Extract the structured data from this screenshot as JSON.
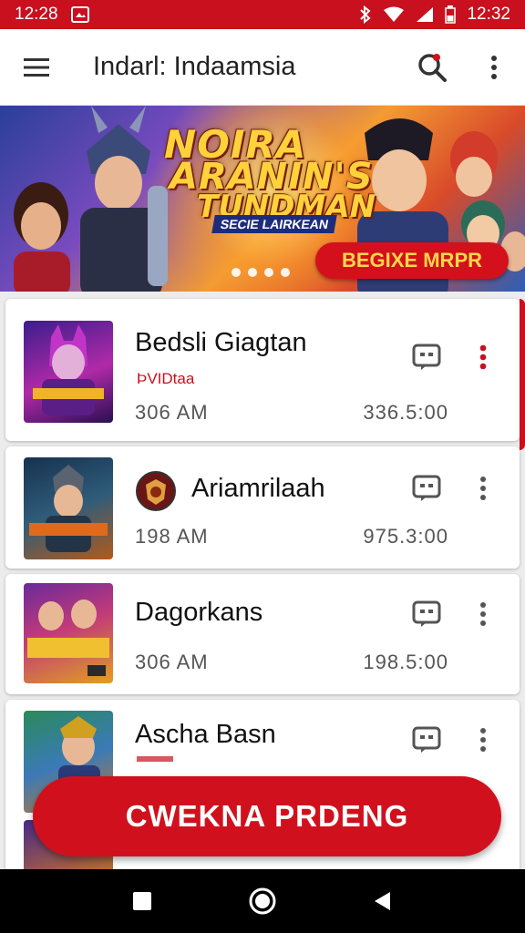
{
  "status_bar": {
    "time_left": "12:28",
    "time_right": "12:32"
  },
  "app_bar": {
    "title": "Indarl: Indaamsia"
  },
  "banner": {
    "title_lines": [
      "NOIRA",
      "ARANIN'S",
      "TUNDMAN"
    ],
    "subtitle": "SECIE LAIRKEAN",
    "cta_label": "BEGIXE MRPR"
  },
  "items": [
    {
      "title": "Bedsli Giagtan",
      "subtitle": "ÞVIDtaa",
      "time": "306  AM",
      "count": "336.5:00"
    },
    {
      "title": "Ariamrilaah",
      "subtitle": "",
      "time": "198  AM",
      "count": "975.3:00"
    },
    {
      "title": "Dagorkans",
      "subtitle": "",
      "time": "306  AM",
      "count": "198.5:00"
    },
    {
      "title": "Ascha Basn",
      "subtitle": "",
      "time": "",
      "count": ""
    }
  ],
  "primary_button": {
    "label": "CWEKNA PRDENG"
  },
  "colors": {
    "accent": "#c8101e",
    "button": "#d0111d"
  }
}
